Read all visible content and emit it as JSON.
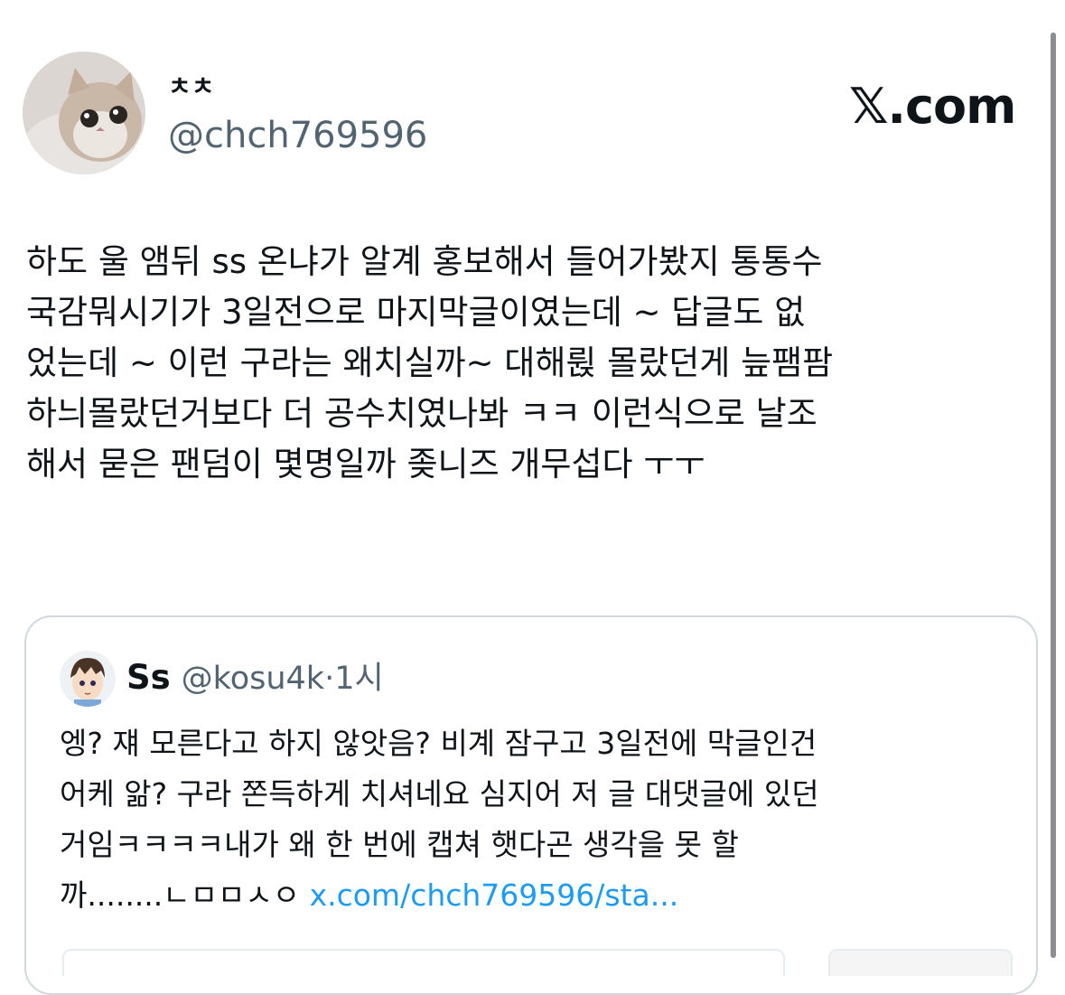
{
  "author": {
    "display_name": "ㅊㅊ",
    "handle": "@chch769596",
    "avatar": "cat-photo-avatar"
  },
  "brand": {
    "logo": "x-logo-icon",
    "text": "𝕏.com"
  },
  "post": {
    "lines": [
      "하도 울 앰뒤 ss 온냐가 알계 홍보해서 들어가봤지 통통수",
      "국감뭐시기가 3일전으로 마지막글이였는데 ~ 답글도 없",
      "었는데 ~ 이런 구라는 왜치실까~ 대해륁 몰랐던게 늪팸팜",
      "하늬몰랐던거보다 더 공수치였나봐 ㅋㅋ 이런식으로 날조",
      "해서 묻은 팬덤이 몇명일까 좆니즈 개무섭다 ㅜㅜ"
    ]
  },
  "quote": {
    "display_name": "Ss",
    "handle": "@kosu4k",
    "separator": "·",
    "time": "1시",
    "avatar": "anime-boy-avatar",
    "lines": [
      "엥? 쟤 모른다고 하지 않앗음? 비계 잠구고 3일전에 막글인건",
      "어케 앎? 구라 쫀득하게 치셔네요 심지어 저 글 대댓글에 있던",
      "거임ㅋㅋㅋㅋ내가 왜 한 번에 캡쳐 햇다곤 생각을 못 할"
    ],
    "last_line_text": "까........ㄴㅁㅁㅅㅇ ",
    "link": "x.com/chch769596/sta..."
  },
  "colors": {
    "text": "#0f1419",
    "secondary": "#536471",
    "link": "#1d9bf0",
    "border": "#cfd9de",
    "background": "#ffffff"
  }
}
